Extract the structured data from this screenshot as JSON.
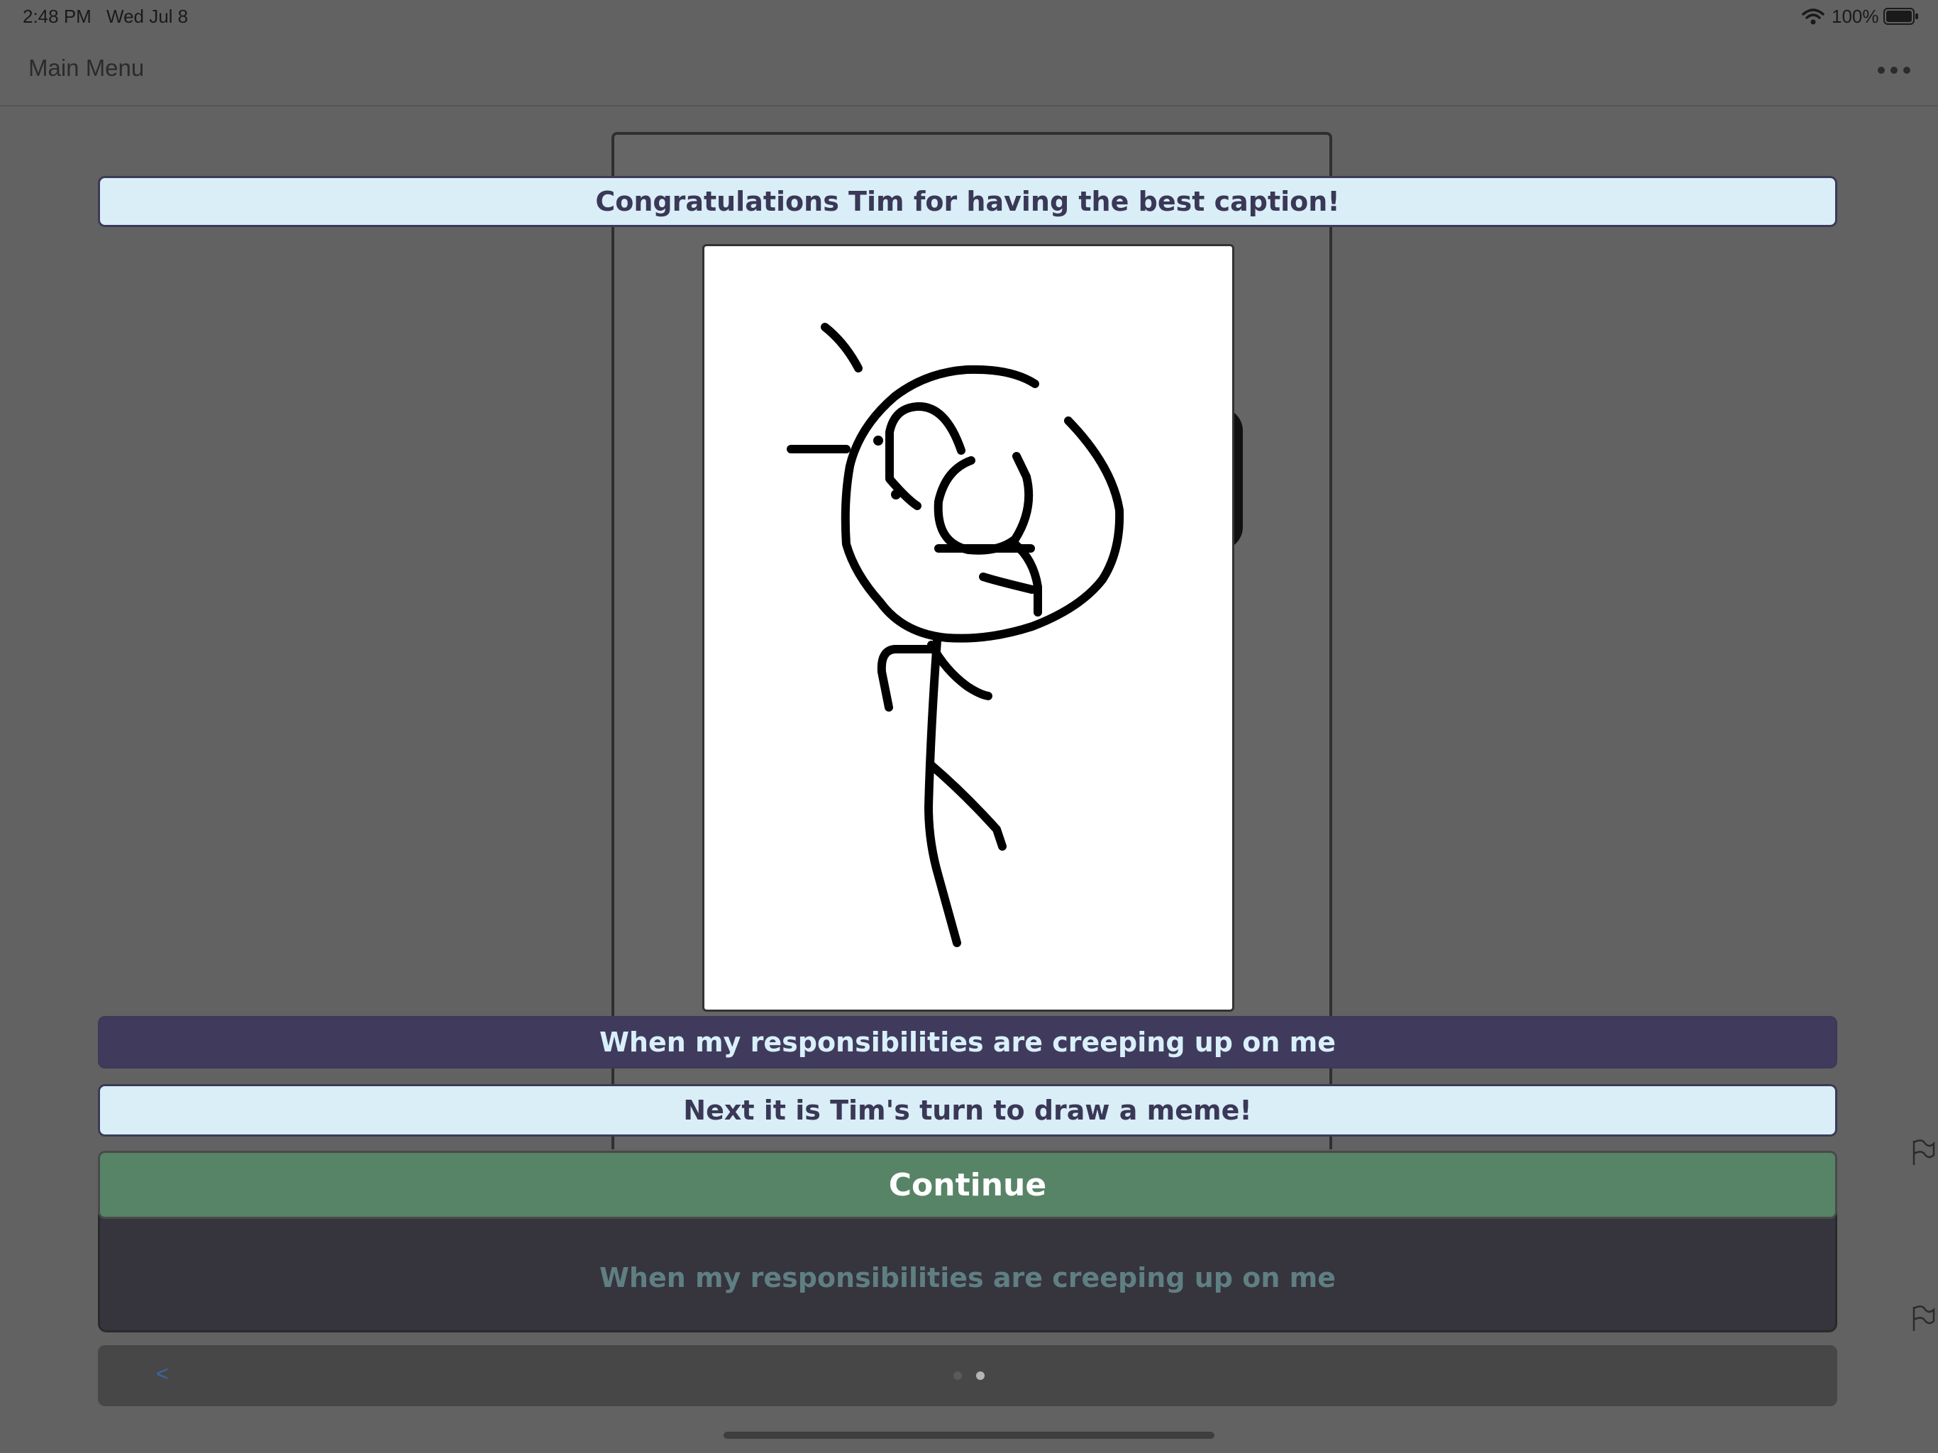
{
  "status_bar": {
    "time": "2:48 PM",
    "date": "Wed Jul 8",
    "battery": "100%",
    "wifi_icon": "wifi-icon",
    "battery_icon": "battery-icon"
  },
  "nav": {
    "back_label": "Main Menu",
    "more_icon": "more-icon"
  },
  "game": {
    "winner_message": "Congratulations Tim for having the best caption!",
    "winning_caption": "When my responsibilities are creeping up on me",
    "next_message": "Next it is Tim's turn to draw a meme!",
    "continue_label": "Continue",
    "caption_echo": "When my responsibilities are creeping up on me",
    "drawing": "stick-figure-drawing"
  },
  "pager": {
    "back_label": "<",
    "page_count": 2,
    "current_page": 2
  },
  "colors": {
    "banner_light": "#d9eef7",
    "banner_dark": "#403b5c",
    "continue_green": "#578466",
    "background": "#626262"
  }
}
